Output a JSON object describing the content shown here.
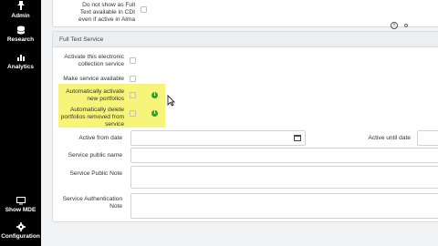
{
  "nav": {
    "items": [
      {
        "label": "Admin",
        "icon": "admin-icon"
      },
      {
        "label": "Research",
        "icon": "research-icon"
      },
      {
        "label": "Analytics",
        "icon": "analytics-icon"
      },
      {
        "label": "Show MDE",
        "icon": "mde-icon"
      },
      {
        "label": "Configuration",
        "icon": "gear-icon"
      }
    ]
  },
  "top_section": {
    "cdi_label": "Do not show as Full Text available in CDI even if active in Alma"
  },
  "full_text_service": {
    "title": "Full Text Service",
    "activate_label": "Activate this electronic collection service",
    "make_available_label": "Make service available",
    "auto_activate_label": "Automatically activate new portfolios",
    "auto_delete_label": "Automatically delete portfolios removed from service",
    "active_from_label": "Active from date",
    "active_until_label": "Active until date",
    "public_name_label": "Service public name",
    "public_note_label": "Service Public Note",
    "auth_note_label": "Service Authentication Note",
    "highlight_color": "#f6f57a",
    "info_color": "#3a9d23"
  }
}
